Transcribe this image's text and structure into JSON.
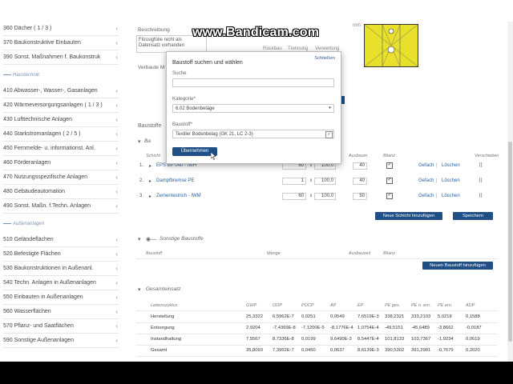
{
  "watermark": "www.Bandicam.com",
  "sidebar": {
    "items_top": [
      {
        "label": "360 Dächer ( 1 / 3 )"
      },
      {
        "label": "370 Baukonstruktive Einbauten"
      },
      {
        "label": "390 Sonst. Maßnahmen f. Baukonstruk"
      }
    ],
    "group_haustechnik": "Haustechnik",
    "items_haustechnik": [
      {
        "label": "410 Abwasser-, Wasser-, Gasanlagen"
      },
      {
        "label": "420 Wärmeversorgungsanlagen ( 1 / 3 )"
      },
      {
        "label": "430 Lufttechnische Anlagen"
      },
      {
        "label": "440 Starkstromanlagen ( 2 / 5 )"
      },
      {
        "label": "450 Fernmelde- u. informationst. Anl."
      },
      {
        "label": "460 Förderanlagen"
      },
      {
        "label": "470 Nutzungsspezifische Anlagen"
      },
      {
        "label": "480 Gebäudeautomation"
      },
      {
        "label": "490 Sonst. Maßn. f.Techn. Anlagen"
      }
    ],
    "group_aussenanlagen": "Außenanlagen",
    "items_aussenanlagen": [
      {
        "label": "510 Geländeflächen"
      },
      {
        "label": "520 Befestigte Flächen"
      },
      {
        "label": "530 Baukonstruktionen in Außenanl."
      },
      {
        "label": "540 Techn. Anlagen in Außenanlagen"
      },
      {
        "label": "550 Einbauten in Außenanlagen"
      },
      {
        "label": "560 Wasserflächen"
      },
      {
        "label": "570 Pflanz- und Saatflächen"
      },
      {
        "label": "590 Sonstige Außenanlagen"
      }
    ]
  },
  "main": {
    "beschreibung_label": "Beschreibung",
    "beschreibung_text": "Flüssigfolie nicht als Datensatz vorhanden",
    "verbaute_label": "Verbaute M",
    "col_rueckbau": "Rückbau",
    "col_trennung": "Trennung",
    "col_verwertung": "Verwertung",
    "mm_label": "mm",
    "baustoffe_title": "Baustoffe",
    "bauteil_label": "Ba",
    "schicht_header": "Schicht",
    "ausbaum_header": "Ausbaum",
    "bilanz_header": "Bilanz",
    "verschieben_header": "Verschieben",
    "layers": [
      {
        "num": "1.",
        "name": "EPS BP 040 - IWH",
        "thickness": "60",
        "percent": "100,0",
        "ausbau": "40",
        "edit": "Gefach",
        "delete": "Löschen"
      },
      {
        "num": "2.",
        "name": "Dampfbremse PE",
        "thickness": "1",
        "percent": "100,0",
        "ausbau": "40",
        "edit": "Gefach",
        "delete": "Löschen"
      },
      {
        "num": "3.",
        "name": "Zementestrich - IWM",
        "thickness": "60",
        "percent": "100,0",
        "ausbau": "50",
        "edit": "Gefach",
        "delete": "Löschen"
      }
    ],
    "btn_neue_schicht": "Neue Schicht hinzufügen",
    "btn_speichern": "Speichern",
    "sonstige_title": "Sonstige Baustoffe",
    "sonstige_cols": {
      "baustoff": "Baustoff",
      "menge": "Menge",
      "ausbau": "Ausbauzeit",
      "bilanz": "Bilanz"
    },
    "btn_neuer_baustoff": "Neuen Baustoff hinzufügen",
    "gesamt_title": "Gesamteinsatz",
    "summary_headers": [
      "Lebenszyklus",
      "GWP",
      "ODP",
      "POCP",
      "AP",
      "EP",
      "PE ges.",
      "PE n. ern.",
      "PE ern.",
      "ADP"
    ],
    "summary_rows": [
      [
        "Herstellung",
        "25,3322",
        "6,5962E-7",
        "0,0251",
        "0,0549",
        "7,6519E-3",
        "338,2321",
        "333,2103",
        "5,0218",
        "0,1588"
      ],
      [
        "Entsorgung",
        "2,9204",
        "-7,4369E-8",
        "-7,1200E-5",
        "-8,1776E-4",
        "1,0754E-4",
        "-49,5151",
        "-45,6489",
        "-3,8662",
        "-0,0187"
      ],
      [
        "Instandhaltung",
        "7,5567",
        "8,7336E-8",
        "0,0199",
        "9,6490E-3",
        "8,5447E-4",
        "101,8133",
        "103,7367",
        "-1,9234",
        "0,0619"
      ],
      [
        "Gesamt",
        "35,8093",
        "7,3952E-7",
        "0,0450",
        "0,0637",
        "8,6139E-3",
        "390,5302",
        "391,2981",
        "-0,7679",
        "0,2020"
      ]
    ]
  },
  "modal": {
    "title": "Baustoff suchen und wählen",
    "close": "Schließen",
    "suche_label": "Suche",
    "suche_value": "",
    "kategorie_label": "Kategorie*",
    "kategorie_value": "6.02 Bodenbeläge",
    "baustoff_label": "Baustoff*",
    "baustoff_value": "Textiler Bodenbelag (GK 21, LC 2-3)",
    "submit": "Übernehmen"
  }
}
